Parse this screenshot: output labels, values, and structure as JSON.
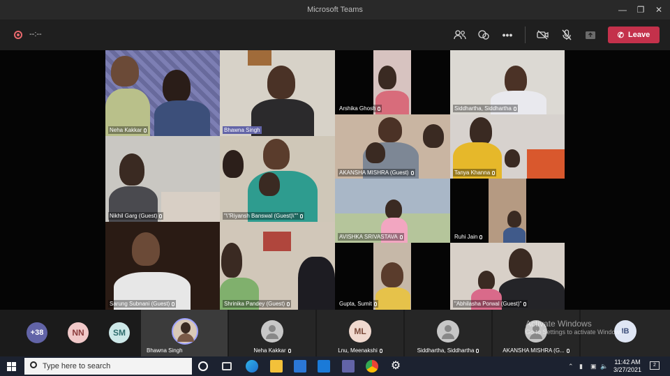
{
  "window": {
    "title": "Microsoft Teams"
  },
  "toolbar": {
    "timer": "--:--",
    "leave_label": "Leave"
  },
  "tiles": [
    {
      "name": "Neha Kakkar"
    },
    {
      "name": "Bhawna Singh"
    },
    {
      "name": "Arshika Ghosh"
    },
    {
      "name": "Siddhartha, Siddhartha"
    },
    {
      "name": "Nikhil Garg (Guest)"
    },
    {
      "name": "\"\\\"Riyansh Banswal (Guest)\\\"\""
    },
    {
      "name": "AKANSHA MISHRA (Guest)"
    },
    {
      "name": "Tanya Khanna"
    },
    {
      "name": "AVISHKA SRIVASTAVA"
    },
    {
      "name": "Ruhi Jain"
    },
    {
      "name": "Sarung Subnani (Guest)"
    },
    {
      "name": "Shrinika Pandey (Guest)"
    },
    {
      "name": "Gupta, Sumit"
    },
    {
      "name": "\"Abhilasha Porwal (Guest)\""
    }
  ],
  "strip": {
    "overflow_count": "+38",
    "initial_avatars": [
      "NN",
      "SM"
    ],
    "participants": [
      {
        "name": "Bhawna Singh"
      },
      {
        "name": "Neha Kakkar"
      },
      {
        "name": "Lnu, Meenakshi",
        "initials": "ML"
      },
      {
        "name": "Siddhartha, Siddhartha"
      },
      {
        "name": "AKANSHA MISHRA (G..."
      }
    ],
    "last_avatar": "IB"
  },
  "watermark": {
    "title": "Activate Windows",
    "subtitle": "Go to Settings to activate Windows."
  },
  "taskbar": {
    "search_placeholder": "Type here to search",
    "time": "11:42 AM",
    "date": "3/27/2021",
    "notification_count": "2"
  },
  "colors": {
    "leave": "#c4314b",
    "accent": "#6264a7",
    "avatar_plus": "#6264a7",
    "avatar_nn": "#f1c9c9",
    "avatar_sm": "#cde8e8",
    "avatar_ml": "#f0d9cf",
    "avatar_ib": "#dfe6f4"
  }
}
